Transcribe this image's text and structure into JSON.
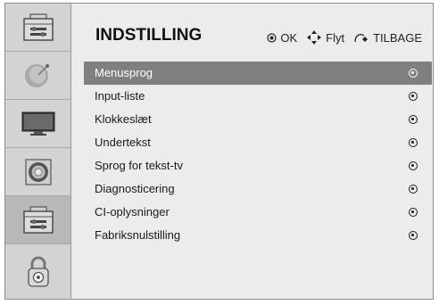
{
  "header": {
    "title": "INDSTILLING",
    "hints": [
      {
        "icon": "ok-button-icon",
        "label": "OK"
      },
      {
        "icon": "move-arrows-icon",
        "label": "Flyt"
      },
      {
        "icon": "back-icon",
        "label": "TILBAGE"
      }
    ]
  },
  "sidebar": {
    "items": [
      {
        "icon": "option-toolbox-icon",
        "active": false
      },
      {
        "icon": "satellite-dish-icon",
        "active": false
      },
      {
        "icon": "monitor-icon",
        "active": false
      },
      {
        "icon": "speaker-icon",
        "active": false
      },
      {
        "icon": "option-toolbox-icon",
        "active": true
      },
      {
        "icon": "padlock-icon",
        "active": false
      }
    ]
  },
  "menu": {
    "items": [
      {
        "label": "Menusprog",
        "selected": true
      },
      {
        "label": "Input-liste",
        "selected": false
      },
      {
        "label": "Klokkeslæt",
        "selected": false
      },
      {
        "label": "Undertekst",
        "selected": false
      },
      {
        "label": "Sprog for tekst-tv",
        "selected": false
      },
      {
        "label": "Diagnosticering",
        "selected": false
      },
      {
        "label": "CI-oplysninger",
        "selected": false
      },
      {
        "label": "Fabriksnulstilling",
        "selected": false
      }
    ]
  }
}
